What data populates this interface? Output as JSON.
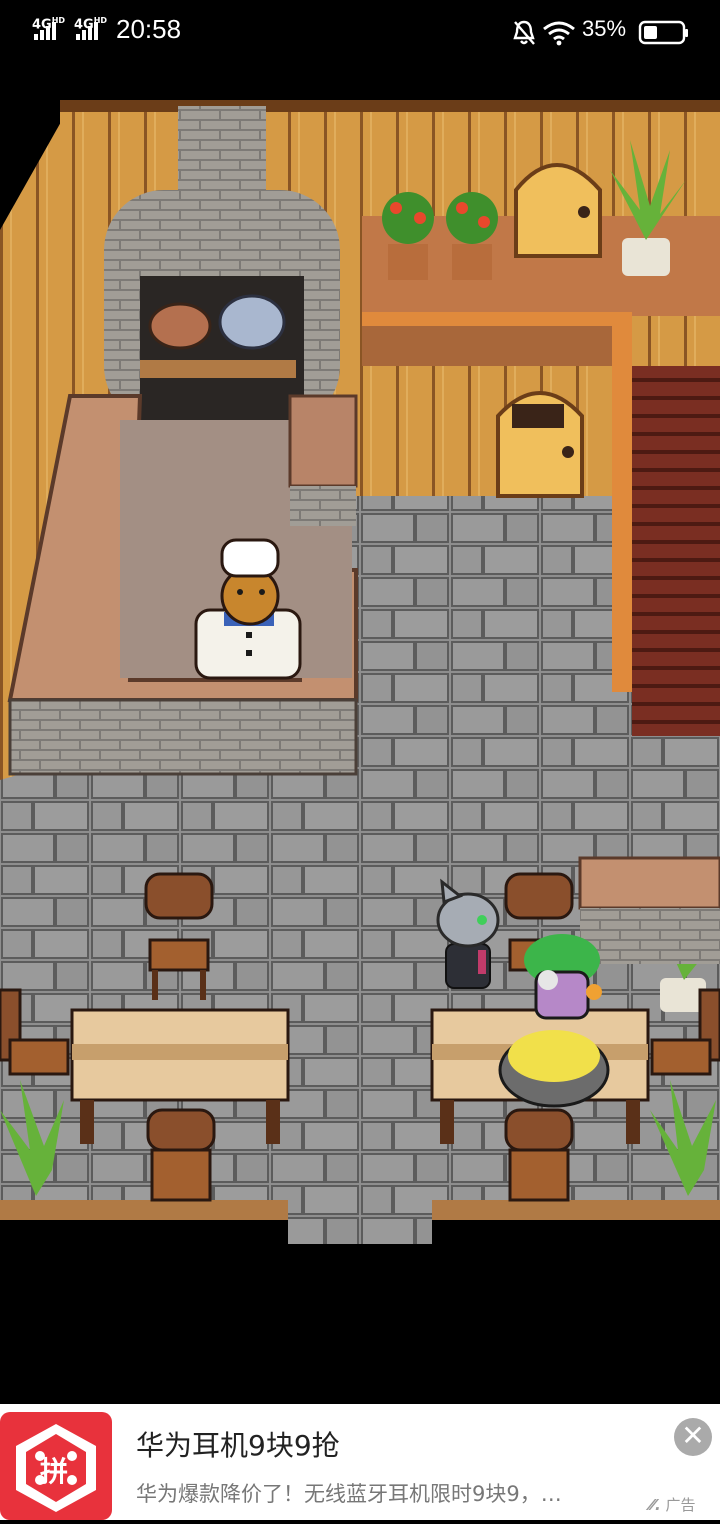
{
  "status_bar": {
    "signal_1": "4G",
    "signal_1_sup": "HD",
    "signal_2": "4G",
    "signal_2_sup": "HD",
    "time": "20:58",
    "battery_percent": "35%",
    "battery_level": 0.35,
    "icons": [
      "mute-bell-icon",
      "wifi-icon",
      "battery-icon"
    ]
  },
  "game": {
    "location": "tavern-kitchen",
    "characters": [
      "bear-chef",
      "grey-cat-player",
      "green-haired-customer"
    ]
  },
  "ad": {
    "logo_glyph": "拼",
    "title": "华为耳机9块9抢",
    "description": "华为爆款降价了！无线蓝牙耳机限时9块9，…",
    "tag": "广告",
    "close_label": "✕"
  }
}
